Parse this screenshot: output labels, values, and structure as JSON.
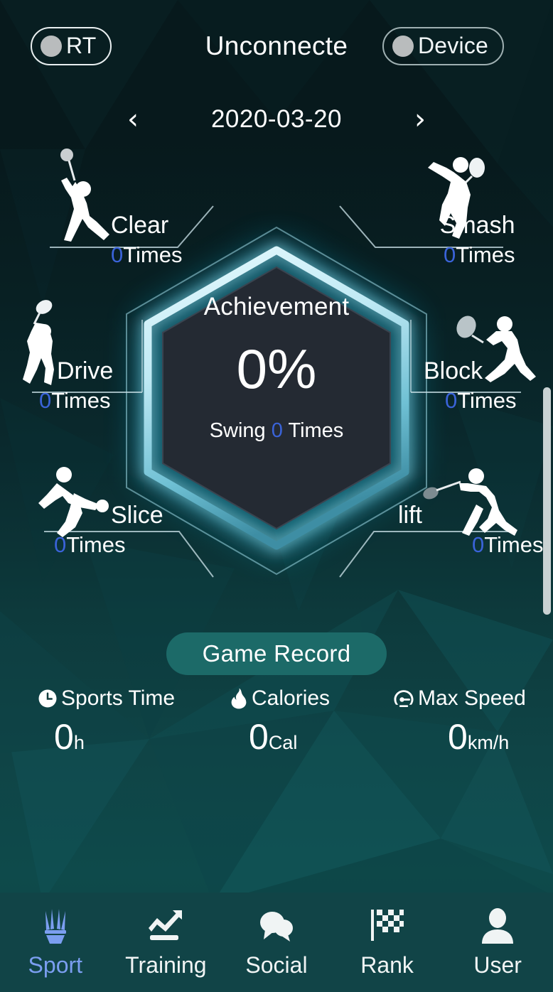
{
  "header": {
    "rt_toggle": {
      "label": "RT",
      "name": "rt-toggle"
    },
    "connection_status": "Unconnecte",
    "device_toggle": {
      "label": "Device",
      "name": "device-toggle"
    }
  },
  "date_nav": {
    "prev_icon": "chevron-left-icon",
    "prev_label": "‹",
    "date": "2020-03-20",
    "next_icon": "chevron-right-icon",
    "next_label": "›"
  },
  "hexagon": {
    "achievement_label": "Achievement",
    "achievement_value": "0%",
    "swing_prefix": "Swing",
    "swing_count": "0",
    "swing_suffix": "Times",
    "glow_color": "#bfecf5",
    "fill_color": "#242a33"
  },
  "strokes": [
    {
      "name": "Clear",
      "count": "0",
      "unit": "Times",
      "icon": "badminton-clear-icon"
    },
    {
      "name": "Smash",
      "count": "0",
      "unit": "Times",
      "icon": "badminton-smash-icon"
    },
    {
      "name": "Drive",
      "count": "0",
      "unit": "Times",
      "icon": "badminton-drive-icon"
    },
    {
      "name": "Block",
      "count": "0",
      "unit": "Times",
      "icon": "badminton-block-icon"
    },
    {
      "name": "Slice",
      "count": "0",
      "unit": "Times",
      "icon": "badminton-slice-icon"
    },
    {
      "name": "lift",
      "count": "0",
      "unit": "Times",
      "icon": "badminton-lift-icon"
    }
  ],
  "game_record_button": {
    "label": "Game Record",
    "color": "#1c6a68"
  },
  "stats": [
    {
      "label": "Sports Time",
      "value": "0",
      "unit": "h",
      "icon": "clock-icon"
    },
    {
      "label": "Calories",
      "value": "0",
      "unit": "Cal",
      "icon": "flame-icon"
    },
    {
      "label": "Max Speed",
      "value": "0",
      "unit": "km/h",
      "icon": "speedometer-icon"
    }
  ],
  "nav": {
    "active_color": "#7b9ef0",
    "items": [
      {
        "label": "Sport",
        "icon": "shuttlecock-icon",
        "active": true
      },
      {
        "label": "Training",
        "icon": "trend-chart-icon",
        "active": false
      },
      {
        "label": "Social",
        "icon": "chat-bubbles-icon",
        "active": false
      },
      {
        "label": "Rank",
        "icon": "checkered-flag-icon",
        "active": false
      },
      {
        "label": "User",
        "icon": "person-icon",
        "active": false
      }
    ]
  }
}
